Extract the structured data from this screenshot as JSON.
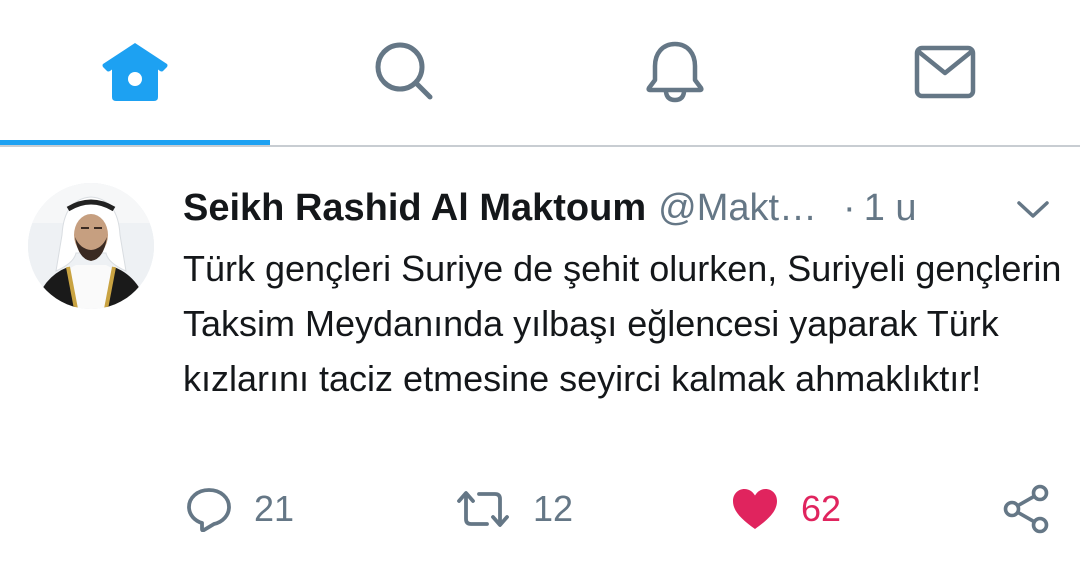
{
  "tabs": [
    {
      "name": "home",
      "icon": "home-icon",
      "active": true
    },
    {
      "name": "search",
      "icon": "search-icon",
      "active": false
    },
    {
      "name": "notifications",
      "icon": "bell-icon",
      "active": false
    },
    {
      "name": "messages",
      "icon": "mail-icon",
      "active": false
    }
  ],
  "colors": {
    "accent": "#1da1f2",
    "text_primary": "#14171a",
    "text_secondary": "#657786",
    "like": "#e0245e",
    "icon_inactive": "#657786"
  },
  "tweet": {
    "display_name": "Seikh Rashid Al Maktoum",
    "handle": "@Makt…",
    "separator": "·",
    "time": "1 u",
    "text": "Türk gençleri Suriye de şehit olurken, Suriyeli gençlerin Taksim Meydanında yılbaşı eğlencesi yaparak Türk kızlarını taciz etmesine seyirci kalmak ahmaklıktır!",
    "actions": {
      "replies": "21",
      "retweets": "12",
      "likes": "62",
      "liked": true
    }
  }
}
